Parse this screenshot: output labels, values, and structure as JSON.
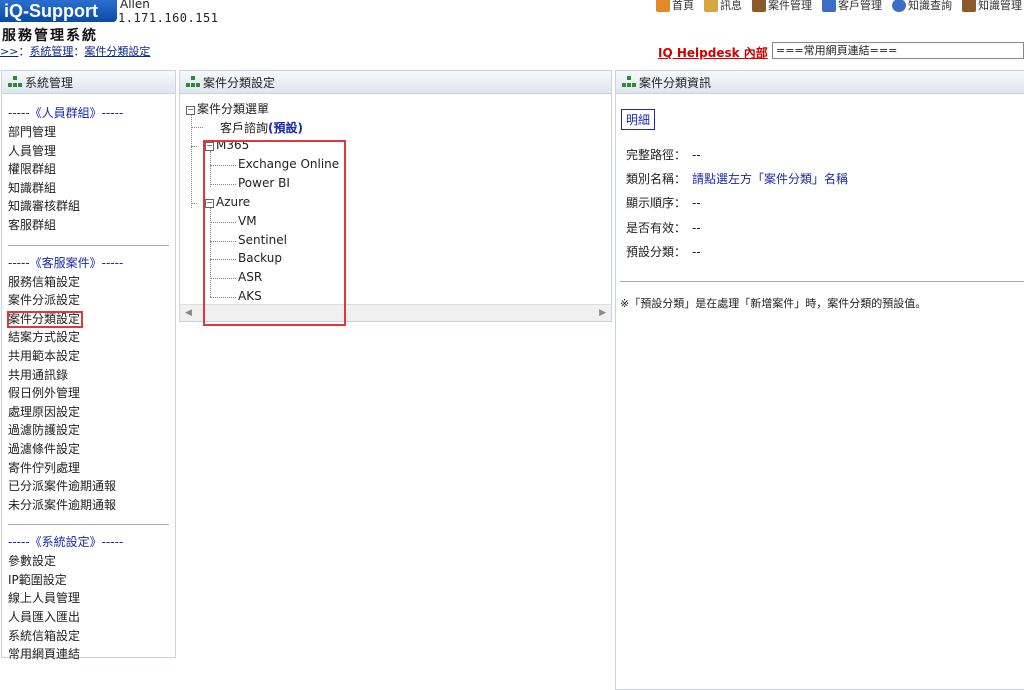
{
  "header": {
    "logo": "iQ-Support",
    "user_name": "Allen",
    "user_ip": "1.171.160.151",
    "system_title": "服務管理系統",
    "breadcrumb": {
      "home": ">>",
      "sep": "：",
      "level1": "系統管理",
      "level2": "案件分類設定"
    },
    "nav": [
      {
        "label": "首頁",
        "icon": "home-icon",
        "color": "#e08a2a"
      },
      {
        "label": "訊息",
        "icon": "mail-icon",
        "color": "#d8a640"
      },
      {
        "label": "案件管理",
        "icon": "folder-icon",
        "color": "#8a5a2a"
      },
      {
        "label": "客戶管理",
        "icon": "customer-icon",
        "color": "#3a6fc4"
      },
      {
        "label": "知識查詢",
        "icon": "search-icon",
        "color": "#3a6fc4"
      },
      {
        "label": "知識管理",
        "icon": "book-icon",
        "color": "#8a5a2a"
      }
    ],
    "helpdesk_link": "IQ Helpdesk 內部",
    "quicklinks_value": "===常用網頁連結==="
  },
  "left_panel": {
    "title": "系統管理",
    "sections": [
      {
        "title": "-----《人員群組》-----",
        "items": [
          "部門管理",
          "人員管理",
          "權限群組",
          "知識群組",
          "知識審核群組",
          "客服群組"
        ]
      },
      {
        "title": "-----《客服案件》-----",
        "items": [
          "服務信箱設定",
          "案件分派設定",
          "案件分類設定",
          "結案方式設定",
          "共用範本設定",
          "共用通訊錄",
          "假日例外管理",
          "處理原因設定",
          "過濾防護設定",
          "過濾條件設定",
          "寄件佇列處理",
          "已分派案件逾期通報",
          "未分派案件逾期通報"
        ]
      },
      {
        "title": "-----《系統設定》-----",
        "items": [
          "參數設定",
          "IP範圍設定",
          "線上人員管理",
          "人員匯入匯出",
          "系統信箱設定",
          "常用網頁連結"
        ]
      }
    ],
    "selected_item": "案件分類設定"
  },
  "middle_panel": {
    "title": "案件分類設定",
    "tree": {
      "root": "案件分類選單",
      "n1_label": "客戶諮詢",
      "n1_suffix": "(預設)",
      "n2": "M365",
      "n2_children": [
        "Exchange Online",
        "Power BI"
      ],
      "n3": "Azure",
      "n3_children": [
        "VM",
        "Sentinel",
        "Backup",
        "ASR",
        "AKS"
      ]
    }
  },
  "right_panel": {
    "title": "案件分類資訊",
    "tab_label": "明細",
    "rows": [
      {
        "label": "完整路徑：",
        "value": "--"
      },
      {
        "label": "類別名稱：",
        "value": "請點選左方「案件分類」名稱"
      },
      {
        "label": "顯示順序：",
        "value": "--"
      },
      {
        "label": "是否有效：",
        "value": "--"
      },
      {
        "label": "預設分類：",
        "value": "--"
      }
    ],
    "note": "※「預設分類」是在處理「新增案件」時，案件分類的預設值。"
  }
}
